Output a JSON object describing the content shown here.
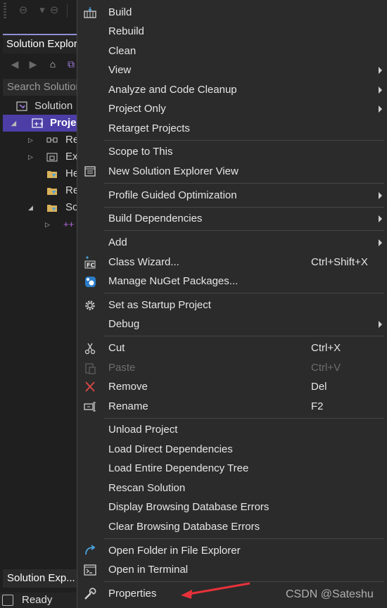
{
  "ide": {
    "solution_explorer_title": "Solution Explorer",
    "search_placeholder": "Search Solution Explorer",
    "tree": [
      {
        "label": "Solution"
      },
      {
        "label": "Project"
      },
      {
        "label": "References"
      },
      {
        "label": "External Dependencies"
      },
      {
        "label": "Header Files"
      },
      {
        "label": "Resource Files"
      },
      {
        "label": "Source Files"
      }
    ],
    "bottom_tab": "Solution Exp...",
    "status": "Ready"
  },
  "menu": {
    "items": [
      {
        "label": "Build",
        "icon": "build-icon"
      },
      {
        "label": "Rebuild"
      },
      {
        "label": "Clean"
      },
      {
        "label": "View",
        "submenu": true
      },
      {
        "label": "Analyze and Code Cleanup",
        "submenu": true
      },
      {
        "label": "Project Only",
        "submenu": true
      },
      {
        "label": "Retarget Projects"
      },
      {
        "label": "Scope to This"
      },
      {
        "label": "New Solution Explorer View",
        "icon": "new-explorer-view-icon"
      },
      {
        "label": "Profile Guided Optimization",
        "submenu": true
      },
      {
        "label": "Build Dependencies",
        "submenu": true
      },
      {
        "label": "Add",
        "submenu": true
      },
      {
        "label": "Class Wizard...",
        "shortcut": "Ctrl+Shift+X",
        "icon": "class-wizard-icon"
      },
      {
        "label": "Manage NuGet Packages...",
        "icon": "nuget-icon"
      },
      {
        "label": "Set as Startup Project",
        "icon": "gear-icon"
      },
      {
        "label": "Debug",
        "submenu": true
      },
      {
        "label": "Cut",
        "shortcut": "Ctrl+X",
        "icon": "scissors-icon"
      },
      {
        "label": "Paste",
        "shortcut": "Ctrl+V",
        "icon": "paste-icon",
        "disabled": true
      },
      {
        "label": "Remove",
        "shortcut": "Del",
        "icon": "remove-x-icon"
      },
      {
        "label": "Rename",
        "shortcut": "F2",
        "icon": "rename-icon"
      },
      {
        "label": "Unload Project"
      },
      {
        "label": "Load Direct Dependencies"
      },
      {
        "label": "Load Entire Dependency Tree"
      },
      {
        "label": "Rescan Solution"
      },
      {
        "label": "Display Browsing Database Errors"
      },
      {
        "label": "Clear Browsing Database Errors"
      },
      {
        "label": "Open Folder in File Explorer",
        "icon": "open-folder-icon"
      },
      {
        "label": "Open in Terminal",
        "icon": "terminal-icon"
      },
      {
        "label": "Properties",
        "icon": "wrench-icon"
      }
    ]
  },
  "watermark": "CSDN @Sateshu",
  "colors": {
    "menu_bg": "#2b2b2b",
    "selection": "#4c3ea6",
    "remove_red": "#e04848",
    "arrow_red": "#e8313a",
    "accent_blue": "#4aa3df"
  }
}
